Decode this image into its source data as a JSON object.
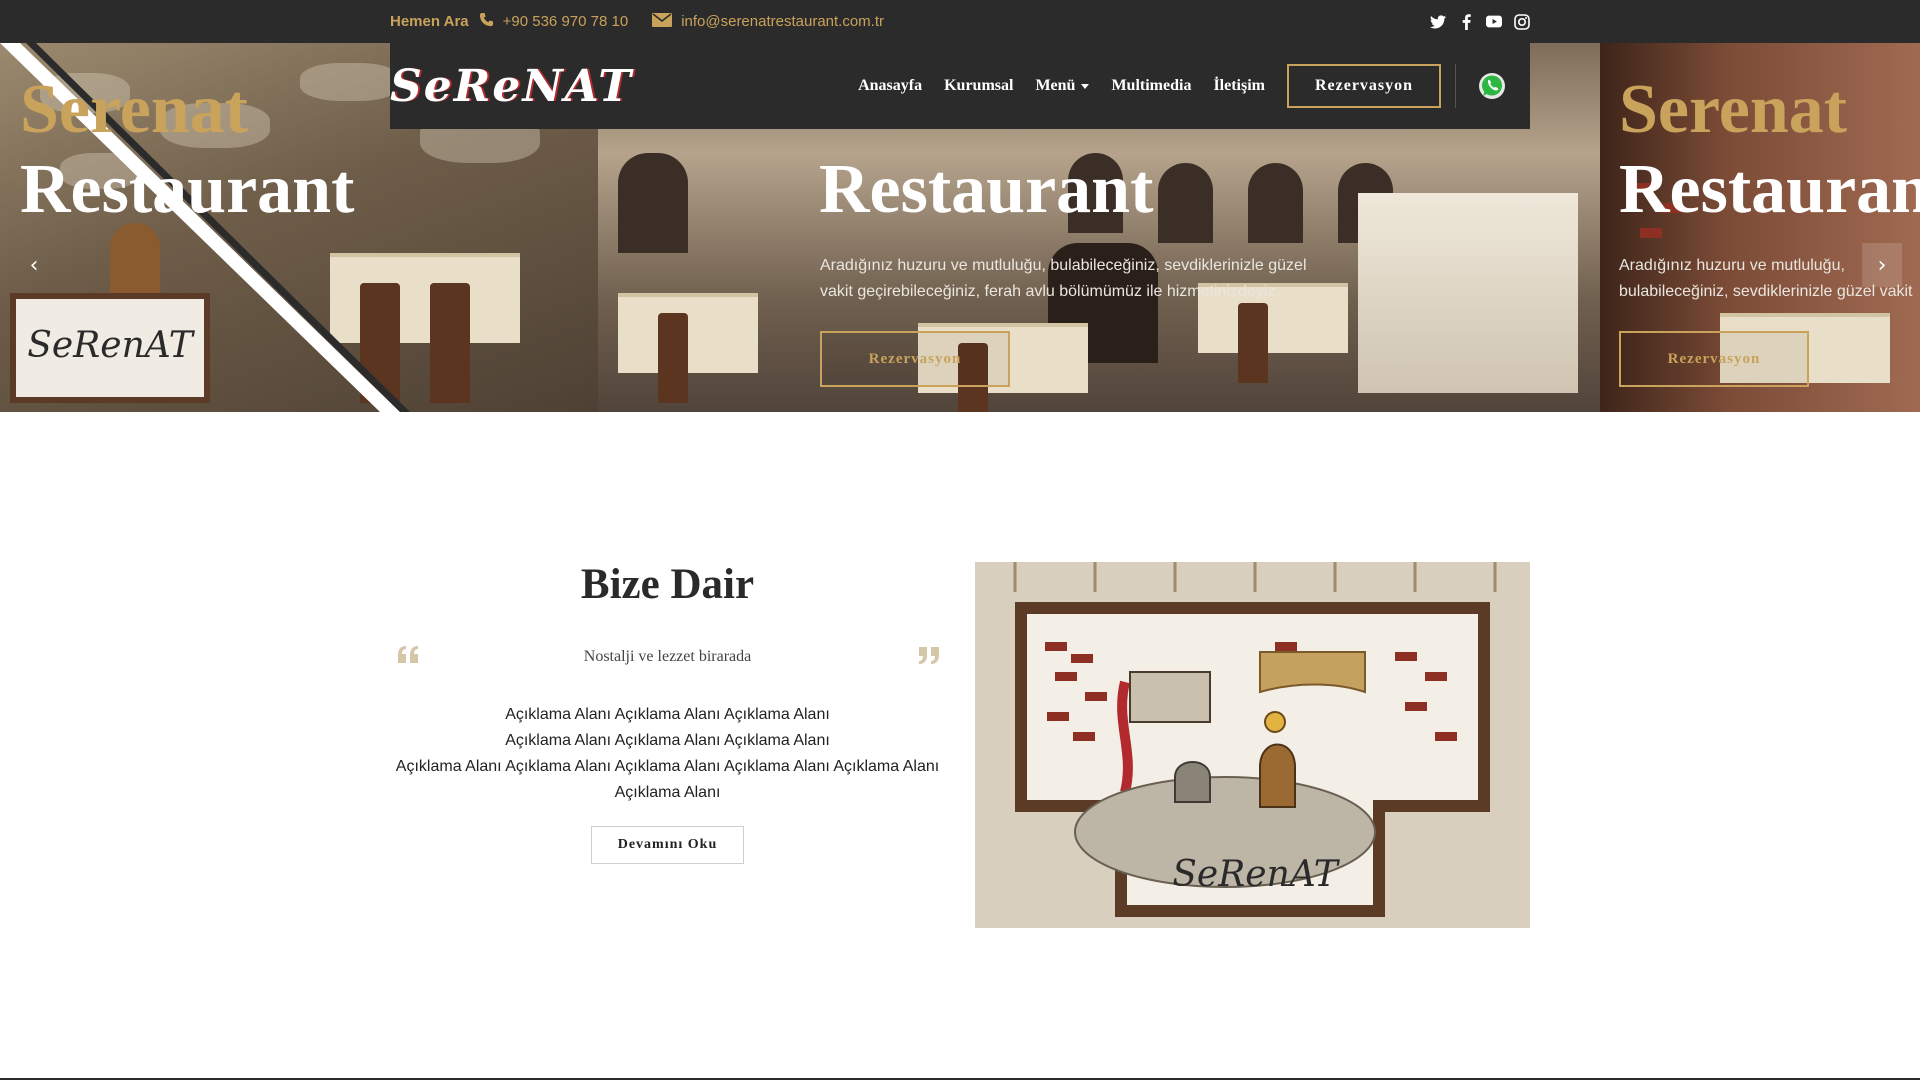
{
  "topbar": {
    "call_label": "Hemen Ara",
    "phone": "+90 536 970 78 10",
    "email": "info@serenatrestaurant.com.tr",
    "icons": [
      "twitter-icon",
      "facebook-icon",
      "youtube-icon",
      "instagram-icon"
    ]
  },
  "header": {
    "logo_text": "SeReNAT",
    "nav": [
      {
        "label": "Anasayfa"
      },
      {
        "label": "Kurumsal"
      },
      {
        "label": "Menü"
      },
      {
        "label": "Multimedia"
      },
      {
        "label": "İletişim"
      }
    ],
    "reserve_label": "Rezervasyon"
  },
  "slider": {
    "slides": [
      {
        "title_line1": "Serenat",
        "title_line2": "Restaurant"
      },
      {
        "title_line2": "Restaurant",
        "text": "Aradığınız huzuru ve mutluluğu, bulabileceğiniz, sevdiklerinizle güzel vakit geçirebileceğiniz, ferah avlu bölümümüz ile hizmetinizdeyiz.",
        "button": "Rezervasyon"
      },
      {
        "title_line1": "Serenat",
        "title_line2": "Restaurant",
        "text": "Aradığınız huzuru ve mutluluğu, bulabileceğiniz, sevdiklerinizle güzel vakit geçirebileceğiniz, ferah avlu bölümümüz ile hizmetinizdeyiz.",
        "button": "Rezervasyon"
      }
    ],
    "prev_label": "‹",
    "next_label": "›",
    "wall_sign": "SeRenAT"
  },
  "about": {
    "title": "Bize Dair",
    "subtitle": "Nostalji ve lezzet birarada",
    "description_lines": [
      "Açıklama Alanı Açıklama Alanı Açıklama Alanı",
      "Açıklama Alanı Açıklama Alanı Açıklama Alanı",
      "Açıklama Alanı Açıklama Alanı Açıklama Alanı Açıklama Alanı Açıklama Alanı",
      "Açıklama Alanı"
    ],
    "read_more": "Devamını Oku",
    "image_sign": "SeRenAT"
  },
  "colors": {
    "accent": "#c9a25b",
    "dark": "#2b2b2b"
  }
}
